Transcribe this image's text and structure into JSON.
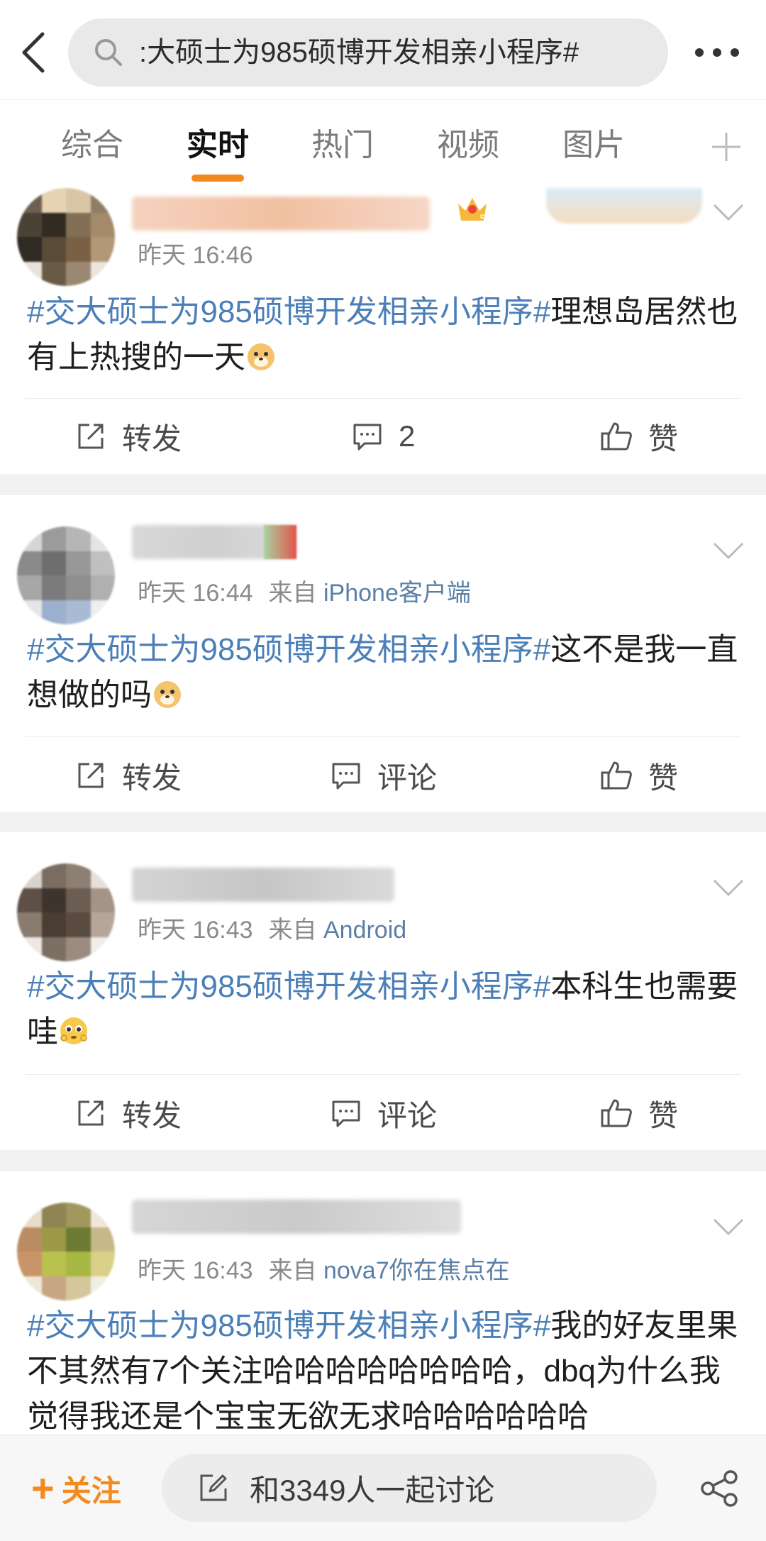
{
  "search": {
    "query": ":大硕士为985硕博开发相亲小程序#"
  },
  "tabs": [
    {
      "label": "综合"
    },
    {
      "label": "实时"
    },
    {
      "label": "热门"
    },
    {
      "label": "视频"
    },
    {
      "label": "图片"
    }
  ],
  "active_tab": "实时",
  "posts": [
    {
      "time": "昨天 16:46",
      "source_prefix": "",
      "source": "",
      "hashtag": "#交大硕士为985硕博开发相亲小程序#",
      "text": "理想岛居然也有上热搜的一天",
      "emoji": "doge-emoji",
      "repost_label": "转发",
      "comment_label": "2",
      "like_label": "赞"
    },
    {
      "time": "昨天 16:44",
      "source_prefix": "来自",
      "source": "iPhone客户端",
      "hashtag": "#交大硕士为985硕博开发相亲小程序#",
      "text": "这不是我一直想做的吗",
      "emoji": "doge-emoji",
      "repost_label": "转发",
      "comment_label": "评论",
      "like_label": "赞"
    },
    {
      "time": "昨天 16:43",
      "source_prefix": "来自",
      "source": "Android",
      "hashtag": "#交大硕士为985硕博开发相亲小程序#",
      "text": "本科生也需要哇",
      "emoji": "pleading-emoji",
      "repost_label": "转发",
      "comment_label": "评论",
      "like_label": "赞"
    },
    {
      "time": "昨天 16:43",
      "source_prefix": "来自",
      "source": "nova7你在焦点在",
      "hashtag": "#交大硕士为985硕博开发相亲小程序#",
      "text": "我的好友里果不其然有7个关注哈哈哈哈哈哈哈哈，dbq为什么我觉得我还是个宝宝无欲无求哈哈哈哈哈哈"
    }
  ],
  "bottom": {
    "follow_label": "关注",
    "discuss_label": "和3349人一起讨论"
  },
  "colors": {
    "accent": "#f28a1e",
    "link": "#4b7fb8",
    "source": "#5b7fa6"
  }
}
